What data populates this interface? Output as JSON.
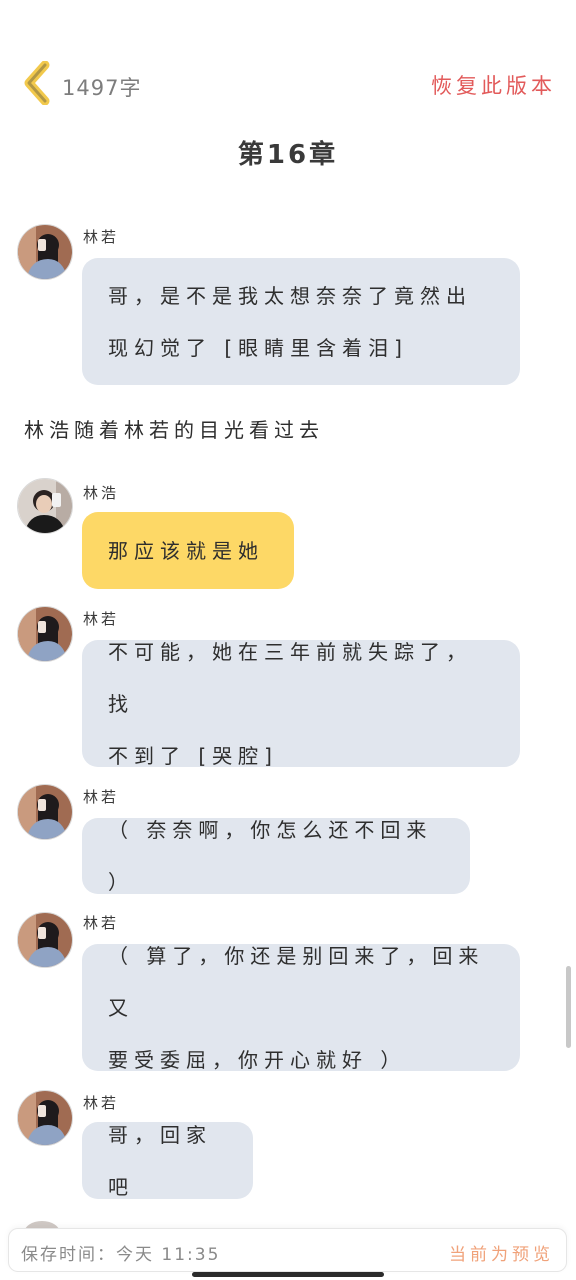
{
  "header": {
    "word_count": "1497字",
    "restore_label": "恢复此版本",
    "back_icon": "chevron-left-icon"
  },
  "chapter_title": "第16章",
  "messages": [
    {
      "speaker": "林若",
      "lines": [
        "哥，是不是我太想奈奈了竟然出",
        "现幻觉了 [眼睛里含着泪]"
      ]
    },
    {
      "narration": "林浩随着林若的目光看过去"
    },
    {
      "speaker": "林浩",
      "lines": [
        "那应该就是她"
      ]
    },
    {
      "speaker": "林若",
      "lines": [
        "不可能，她在三年前就失踪了，找",
        "不到了 [哭腔]"
      ]
    },
    {
      "speaker": "林若",
      "lines": [
        "（ 奈奈啊，你怎么还不回来 ）"
      ]
    },
    {
      "speaker": "林若",
      "lines": [
        "（ 算了，你还是别回来了，回来又",
        "要受委屈，你开心就好 ）"
      ]
    },
    {
      "speaker": "林若",
      "lines": [
        "哥，回家吧"
      ]
    }
  ],
  "footer": {
    "save_time": "保存时间：今天 11:35",
    "preview_status": "当前为预览"
  },
  "colors": {
    "accent_red": "#e25a5a",
    "accent_yellow": "#f2c94c",
    "bubble_gray": "#e1e6ee",
    "bubble_yellow": "#fdd866",
    "preview_orange": "#f0a27a"
  }
}
